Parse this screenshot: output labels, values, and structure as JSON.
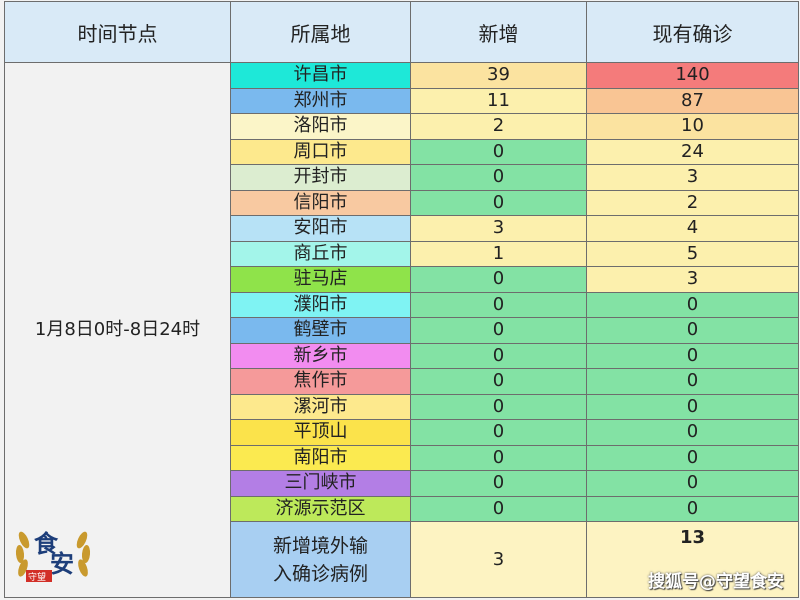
{
  "headers": [
    "时间节点",
    "所属地",
    "新增",
    "现有确诊"
  ],
  "time_period": "1月8日0时-8日24时",
  "rows": [
    {
      "city": "许昌市",
      "city_bg": "#1ee8d8",
      "new": "39",
      "new_bg": "#fbe3a0",
      "current": "140",
      "current_bg": "#f47b7b"
    },
    {
      "city": "郑州市",
      "city_bg": "#7ab9ee",
      "new": "11",
      "new_bg": "#fcf0ad",
      "current": "87",
      "current_bg": "#f9c594"
    },
    {
      "city": "洛阳市",
      "city_bg": "#fbf5c8",
      "new": "2",
      "new_bg": "#fcf0ad",
      "current": "10",
      "current_bg": "#fbe3a0"
    },
    {
      "city": "周口市",
      "city_bg": "#fde98d",
      "new": "0",
      "new_bg": "#83e2a4",
      "current": "24",
      "current_bg": "#fcf0ad"
    },
    {
      "city": "开封市",
      "city_bg": "#dcedd0",
      "new": "0",
      "new_bg": "#83e2a4",
      "current": "3",
      "current_bg": "#fcf0ad"
    },
    {
      "city": "信阳市",
      "city_bg": "#f8c9a1",
      "new": "0",
      "new_bg": "#83e2a4",
      "current": "2",
      "current_bg": "#fcf0ad"
    },
    {
      "city": "安阳市",
      "city_bg": "#b7e2f6",
      "new": "3",
      "new_bg": "#fcf0ad",
      "current": "4",
      "current_bg": "#fcf0ad"
    },
    {
      "city": "商丘市",
      "city_bg": "#a3f5ea",
      "new": "1",
      "new_bg": "#fcf0ad",
      "current": "5",
      "current_bg": "#fcf0ad"
    },
    {
      "city": "驻马店",
      "city_bg": "#8fe34a",
      "new": "0",
      "new_bg": "#83e2a4",
      "current": "3",
      "current_bg": "#fcf0ad"
    },
    {
      "city": "濮阳市",
      "city_bg": "#7ff3f3",
      "new": "0",
      "new_bg": "#83e2a4",
      "current": "0",
      "current_bg": "#83e2a4"
    },
    {
      "city": "鹤壁市",
      "city_bg": "#7ab9ee",
      "new": "0",
      "new_bg": "#83e2a4",
      "current": "0",
      "current_bg": "#83e2a4"
    },
    {
      "city": "新乡市",
      "city_bg": "#f28cf0",
      "new": "0",
      "new_bg": "#83e2a4",
      "current": "0",
      "current_bg": "#83e2a4"
    },
    {
      "city": "焦作市",
      "city_bg": "#f59a9a",
      "new": "0",
      "new_bg": "#83e2a4",
      "current": "0",
      "current_bg": "#83e2a4"
    },
    {
      "city": "漯河市",
      "city_bg": "#fde98d",
      "new": "0",
      "new_bg": "#83e2a4",
      "current": "0",
      "current_bg": "#83e2a4"
    },
    {
      "city": "平顶山",
      "city_bg": "#fbe34b",
      "new": "0",
      "new_bg": "#83e2a4",
      "current": "0",
      "current_bg": "#83e2a4"
    },
    {
      "city": "南阳市",
      "city_bg": "#fbea50",
      "new": "0",
      "new_bg": "#83e2a4",
      "current": "0",
      "current_bg": "#83e2a4"
    },
    {
      "city": "三门峡市",
      "city_bg": "#b37ee5",
      "new": "0",
      "new_bg": "#83e2a4",
      "current": "0",
      "current_bg": "#83e2a4"
    },
    {
      "city": "济源示范区",
      "city_bg": "#bde95a",
      "new": "0",
      "new_bg": "#83e2a4",
      "current": "0",
      "current_bg": "#83e2a4"
    }
  ],
  "footer": {
    "label": "新增境外输入确诊病例",
    "new": "3",
    "current": "13"
  },
  "logo_text": "食安",
  "logo_stamp": "守望",
  "watermark": "搜狐号@守望食安",
  "colors": {
    "header_bg": "#d9eaf7",
    "footer_label_bg": "#a8cff2",
    "footer_value_bg": "#fdf3c2"
  }
}
